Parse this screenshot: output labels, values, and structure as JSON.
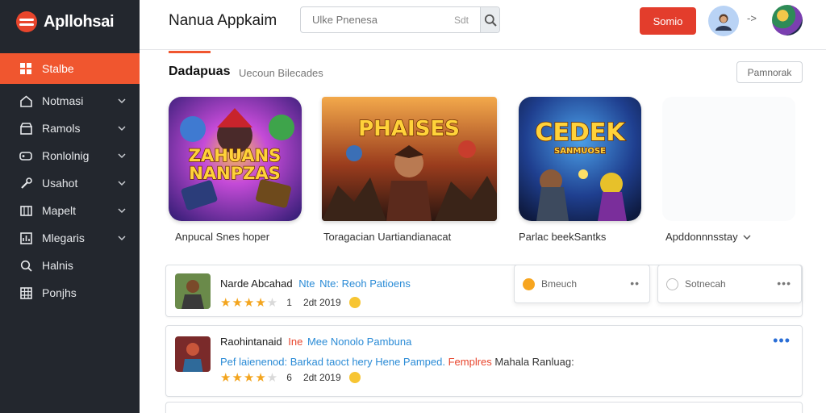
{
  "app": {
    "name": "Apllohsai"
  },
  "header": {
    "title": "Nanua Appkaim",
    "search_placeholder": "Ulke Pnenesa",
    "search_hint": "Sdt",
    "cta_label": "Somio",
    "separator": "->"
  },
  "sidebar": {
    "items": [
      {
        "label": "Stalbe",
        "icon": "grid-icon",
        "active": true,
        "chevron": false
      },
      {
        "label": "Notmasi",
        "icon": "home-icon",
        "active": false,
        "chevron": true
      },
      {
        "label": "Ramols",
        "icon": "store-icon",
        "active": false,
        "chevron": true
      },
      {
        "label": "Ronlolnig",
        "icon": "gamepad-icon",
        "active": false,
        "chevron": true
      },
      {
        "label": "Usahot",
        "icon": "wrench-icon",
        "active": false,
        "chevron": true
      },
      {
        "label": "Mapelt",
        "icon": "map-icon",
        "active": false,
        "chevron": true
      },
      {
        "label": "Mlegaris",
        "icon": "chart-icon",
        "active": false,
        "chevron": true
      },
      {
        "label": "Halnis",
        "icon": "search-icon",
        "active": false,
        "chevron": false
      },
      {
        "label": "Ponjhs",
        "icon": "table-icon",
        "active": false,
        "chevron": false
      }
    ]
  },
  "section": {
    "title": "Dadapuas",
    "subtitle": "Uecoun Bilecades",
    "action_label": "Pamnorak"
  },
  "tiles": [
    {
      "art_line1": "ZAHUANS",
      "art_line2": "NANPZAS",
      "label": "Anpucal Snes hoper"
    },
    {
      "art_line1": "PHAISES",
      "art_line2": "",
      "label": "Toragacian Uartiandianacat"
    },
    {
      "art_line1": "CEDEK",
      "art_line2": "SANMUOSE",
      "label": "Parlac beekSantks"
    },
    {
      "art_line1": "",
      "art_line2": "",
      "label": "Apddonnnsstay"
    }
  ],
  "cards": [
    {
      "title": "Narde Abcahad",
      "tag1": "Nte",
      "tag2": "Nte: Reoh Patioens",
      "stars": 4,
      "rating": "1",
      "date": "2dt 2019",
      "desc": null
    },
    {
      "title": "Raohintanaid",
      "tag1": "Ine",
      "tag2": "Mee Nonolo Pambuna",
      "stars": 4,
      "rating": "6",
      "date": "2dt 2019",
      "desc": {
        "p1": "Pef laienenod: Barkad taoct hery Hene Pamped.",
        "p2": "Femplres",
        "p3": "Mahala Ranluag:"
      }
    }
  ],
  "popovers": [
    {
      "label": "Bmeuch",
      "icon": "emoji-icon"
    },
    {
      "label": "Sotnecah",
      "icon": "emoji-outline-icon"
    }
  ],
  "colors": {
    "accent": "#f0562f",
    "sidebar_bg": "#23272e",
    "cta": "#e33d2c",
    "link_blue": "#2a8bd6",
    "star": "#f3a51f"
  }
}
